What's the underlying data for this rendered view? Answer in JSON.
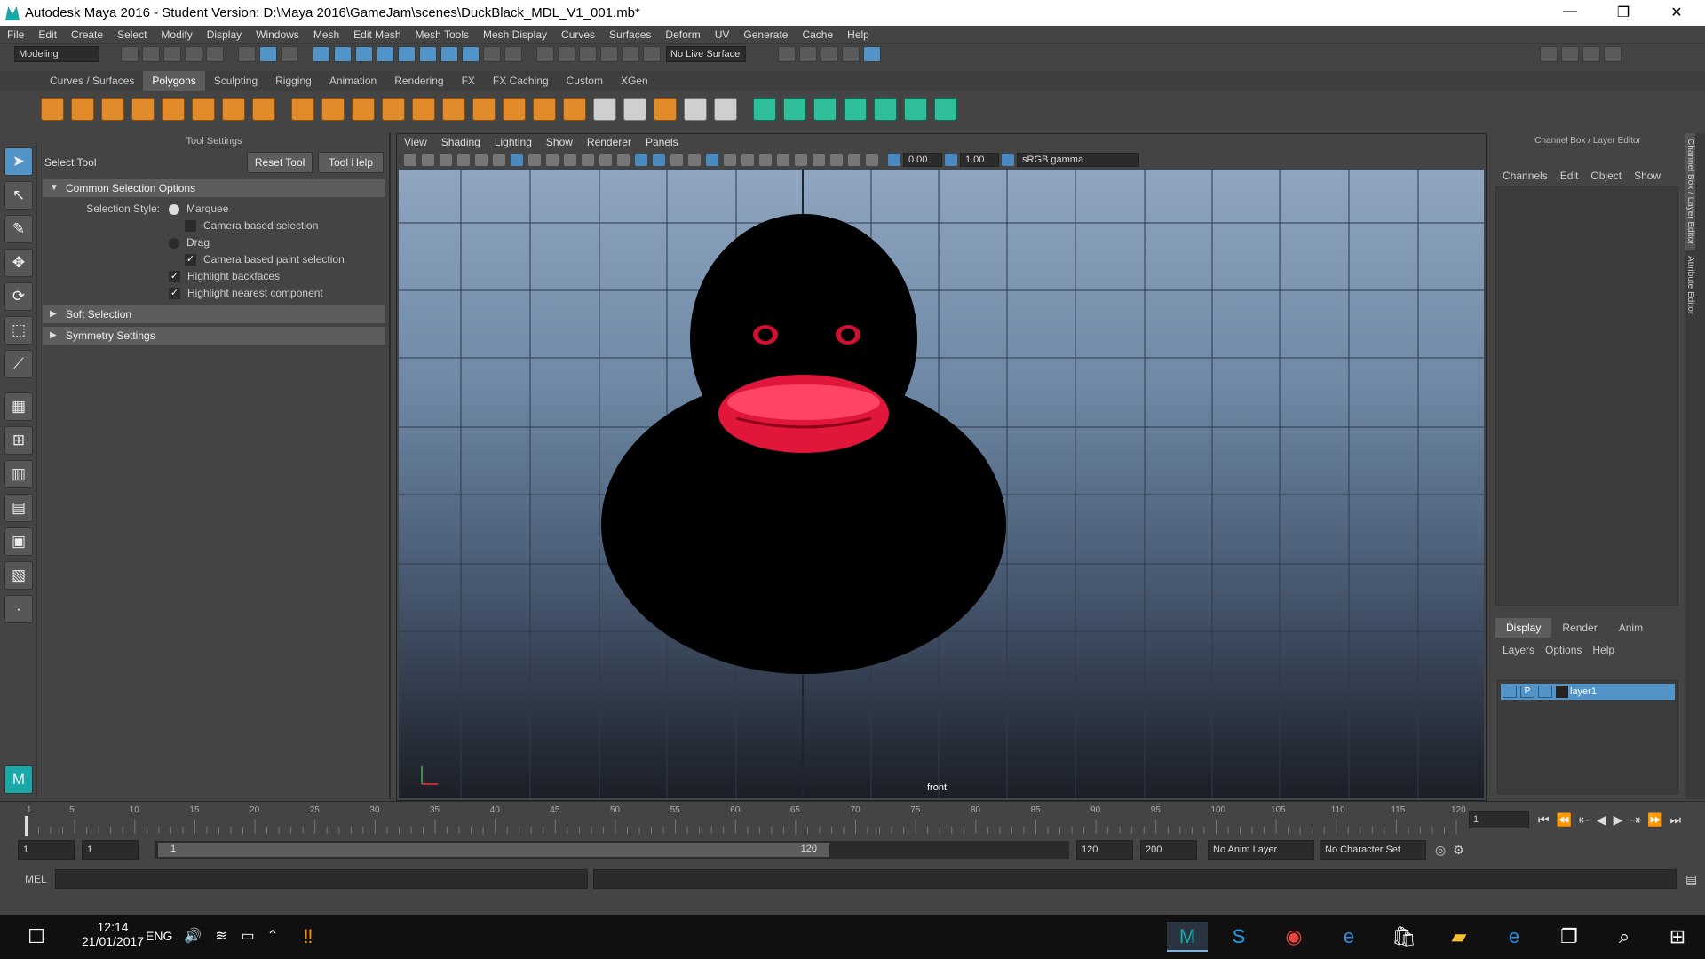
{
  "window": {
    "title": "Autodesk Maya 2016 - Student Version: D:\\Maya 2016\\GameJam\\scenes\\DuckBlack_MDL_V1_001.mb*",
    "minimize": "—",
    "maximize": "❐",
    "close": "✕"
  },
  "menu": [
    "File",
    "Edit",
    "Create",
    "Select",
    "Modify",
    "Display",
    "Windows",
    "Mesh",
    "Edit Mesh",
    "Mesh Tools",
    "Mesh Display",
    "Curves",
    "Surfaces",
    "Deform",
    "UV",
    "Generate",
    "Cache",
    "Help"
  ],
  "status": {
    "menuset": "Modeling",
    "live_surface": "No Live Surface"
  },
  "shelf_tabs": [
    "Curves / Surfaces",
    "Polygons",
    "Sculpting",
    "Rigging",
    "Animation",
    "Rendering",
    "FX",
    "FX Caching",
    "Custom",
    "XGen"
  ],
  "shelf_active": "Polygons",
  "tool_settings": {
    "header": "Tool Settings",
    "tool_name": "Select Tool",
    "reset": "Reset Tool",
    "help": "Tool Help",
    "section_common": "Common Selection Options",
    "selection_style_label": "Selection Style:",
    "marquee": "Marquee",
    "camera_sel": "Camera based selection",
    "drag": "Drag",
    "camera_paint": "Camera based paint selection",
    "highlight_back": "Highlight backfaces",
    "highlight_near": "Highlight nearest component",
    "soft": "Soft Selection",
    "symmetry": "Symmetry Settings"
  },
  "viewport": {
    "menus": [
      "View",
      "Shading",
      "Lighting",
      "Show",
      "Renderer",
      "Panels"
    ],
    "exposure": "0.00",
    "gamma": "1.00",
    "colorspace": "sRGB gamma",
    "camera": "front"
  },
  "channel_box": {
    "header": "Channel Box / Layer Editor",
    "menus": [
      "Channels",
      "Edit",
      "Object",
      "Show"
    ]
  },
  "layer_editor": {
    "tabs": [
      "Display",
      "Render",
      "Anim"
    ],
    "menus": [
      "Layers",
      "Options",
      "Help"
    ],
    "layer": "layer1",
    "p": "P"
  },
  "side_tabs": [
    "Channel Box / Layer Editor",
    "Attribute Editor"
  ],
  "timeline": {
    "ticks": [
      "1",
      "5",
      "10",
      "15",
      "20",
      "25",
      "30",
      "35",
      "40",
      "45",
      "50",
      "55",
      "60",
      "65",
      "70",
      "75",
      "80",
      "85",
      "90",
      "95",
      "100",
      "105",
      "110",
      "115",
      "120"
    ],
    "current": "1"
  },
  "range": {
    "start": "1",
    "start2": "1",
    "slider_start": "1",
    "slider_end": "120",
    "end": "120",
    "end2": "200",
    "anim_layer": "No Anim Layer",
    "char_set": "No Character Set"
  },
  "cmd": {
    "label": "MEL"
  },
  "taskbar": {
    "time": "12:14",
    "date": "21/01/2017",
    "lang": "ENG"
  }
}
